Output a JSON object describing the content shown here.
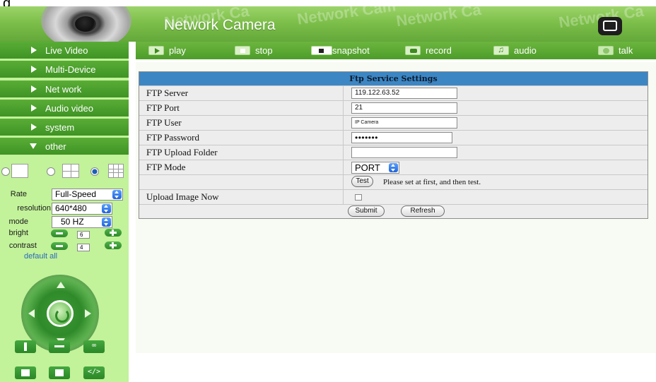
{
  "top_cut_text": "g",
  "header": {
    "title": "Network Camera",
    "watermarks": [
      "Network Ca",
      "Network Cam",
      "Network Ca",
      "Network Ca"
    ]
  },
  "toolbar": {
    "play": "play",
    "stop": "stop",
    "snapshot": "snapshot",
    "record": "record",
    "audio": "audio",
    "talk": "talk"
  },
  "sidebar": {
    "items": [
      {
        "label": "Live Video",
        "expanded": false
      },
      {
        "label": "Multi-Device",
        "expanded": false
      },
      {
        "label": "Net work",
        "expanded": false
      },
      {
        "label": "Audio video",
        "expanded": false
      },
      {
        "label": "system",
        "expanded": false
      },
      {
        "label": "other",
        "expanded": true
      }
    ],
    "controls": {
      "rate_label": "Rate",
      "rate_value": "Full-Speed",
      "resolution_label": "resolution",
      "resolution_value": "640*480",
      "mode_label": "mode",
      "mode_value": "50 HZ",
      "bright_label": "bright",
      "bright_value": "6",
      "contrast_label": "contrast",
      "contrast_value": "4",
      "default_all": "default all"
    },
    "extra_button_labels": [
      "∞",
      "</>"
    ]
  },
  "ftp": {
    "title": "Ftp Service Settings",
    "server_label": "FTP Server",
    "server_value": "119.122.63.52",
    "port_label": "FTP Port",
    "port_value": "21",
    "user_label": "FTP User",
    "user_value": "IP Camera",
    "password_label": "FTP Password",
    "password_value": "•••••••",
    "folder_label": "FTP Upload Folder",
    "folder_value": "",
    "mode_label": "FTP Mode",
    "mode_value": "PORT",
    "test_button": "Test",
    "test_hint": "Please set at first, and then test.",
    "upload_label": "Upload Image Now",
    "upload_checked": false,
    "submit": "Submit",
    "refresh": "Refresh"
  },
  "colors": {
    "header_green": "#7dbf4a",
    "toolbar_green": "#4d9d2a",
    "sidebar_bg": "#c2f29a",
    "nav_green": "#4a9f2c",
    "title_bar_blue": "#3c86c4",
    "row_gray": "#ededed"
  }
}
